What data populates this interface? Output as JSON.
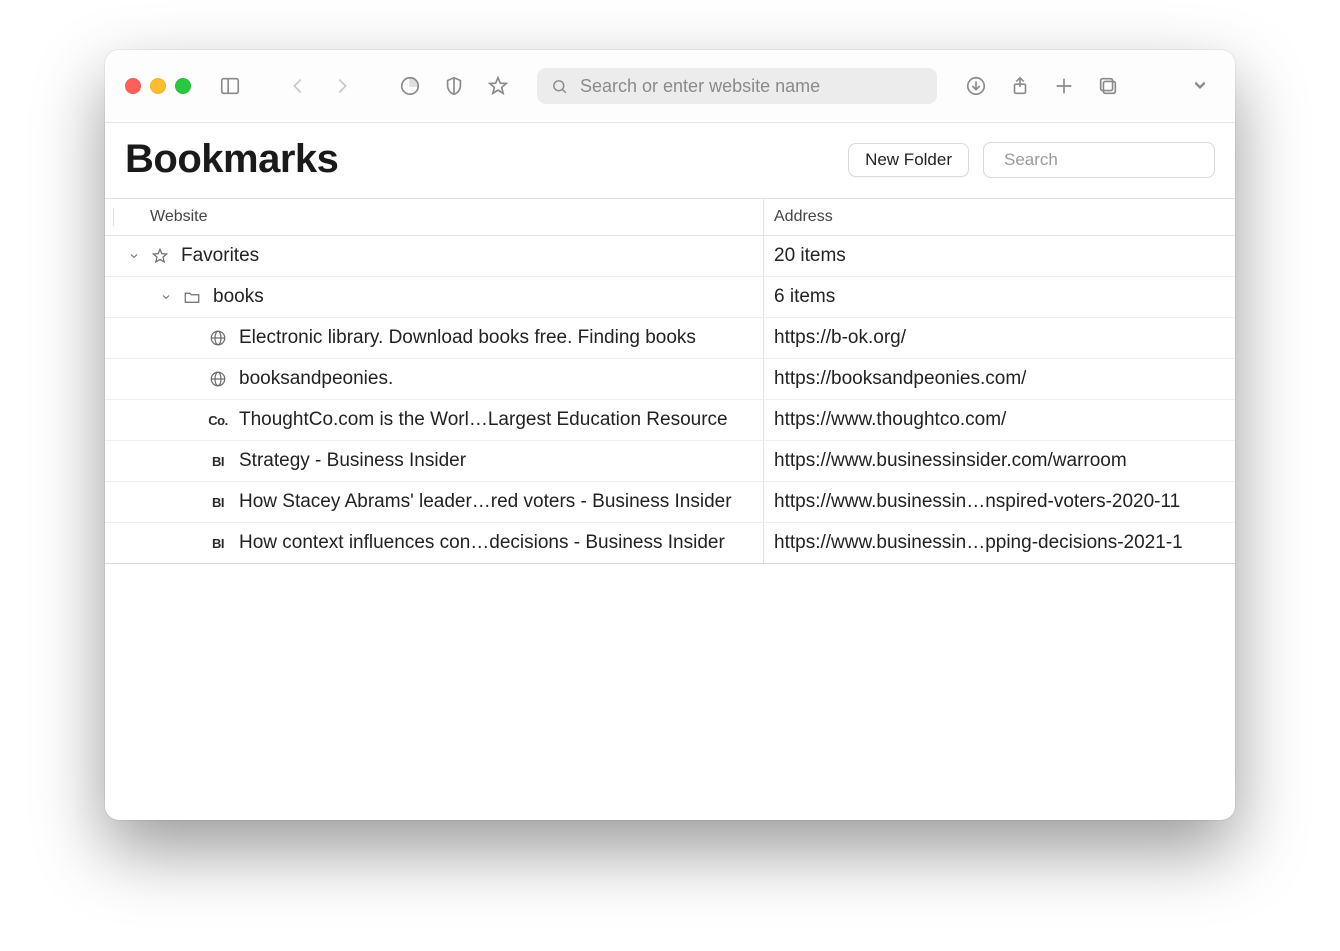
{
  "toolbar": {
    "address_placeholder": "Search or enter website name"
  },
  "page": {
    "title": "Bookmarks",
    "new_folder_label": "New Folder",
    "search_placeholder": "Search"
  },
  "columns": {
    "website": "Website",
    "address": "Address"
  },
  "tree": {
    "favorites": {
      "label": "Favorites",
      "count_text": "20 items"
    },
    "books": {
      "label": "books",
      "count_text": "6 items",
      "items": [
        {
          "icon": "globe",
          "title": "Electronic library. Download books free. Finding books",
          "url": "https://b-ok.org/"
        },
        {
          "icon": "globe",
          "title": "booksandpeonies.",
          "url": "https://booksandpeonies.com/"
        },
        {
          "icon": "Co.",
          "title": "ThoughtCo.com is the Worl…Largest Education Resource",
          "url": "https://www.thoughtco.com/"
        },
        {
          "icon": "BI",
          "title": "Strategy - Business Insider",
          "url": "https://www.businessinsider.com/warroom"
        },
        {
          "icon": "BI",
          "title": "How Stacey Abrams' leader…red voters - Business Insider",
          "url": "https://www.businessin…nspired-voters-2020-11"
        },
        {
          "icon": "BI",
          "title": "How context influences con…decisions - Business Insider",
          "url": "https://www.businessin…pping-decisions-2021-1"
        }
      ]
    }
  }
}
